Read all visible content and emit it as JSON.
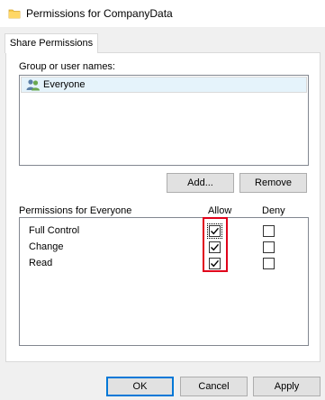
{
  "window": {
    "title": "Permissions for CompanyData"
  },
  "tabs": [
    {
      "label": "Share Permissions",
      "active": true
    }
  ],
  "group": {
    "label": "Group or user names:",
    "users": [
      {
        "name": "Everyone",
        "icon": "users-group-icon",
        "selected": true
      }
    ]
  },
  "buttons": {
    "add": "Add...",
    "remove": "Remove"
  },
  "permissions": {
    "header": "Permissions for Everyone",
    "col_allow": "Allow",
    "col_deny": "Deny",
    "rows": [
      {
        "name": "Full Control",
        "allow": true,
        "deny": false
      },
      {
        "name": "Change",
        "allow": true,
        "deny": false
      },
      {
        "name": "Read",
        "allow": true,
        "deny": false
      }
    ]
  },
  "footer": {
    "ok": "OK",
    "cancel": "Cancel",
    "apply": "Apply"
  },
  "colors": {
    "highlight": "#e0001b",
    "selection": "#e5f3fb",
    "default_button_border": "#0078d7",
    "folder": "#f7c948"
  }
}
